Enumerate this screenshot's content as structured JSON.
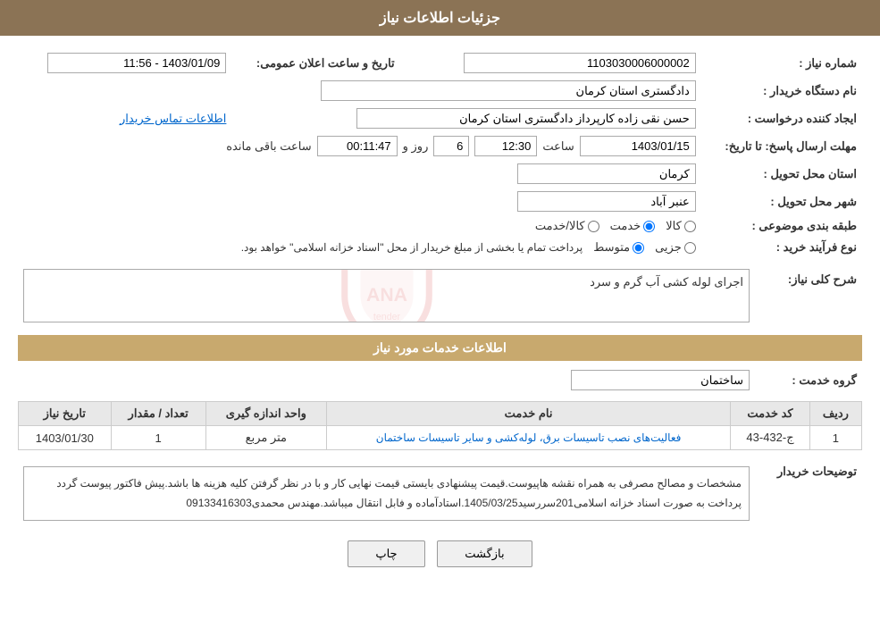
{
  "header": {
    "title": "جزئیات اطلاعات نیاز"
  },
  "fields": {
    "shomara_niaz_label": "شماره نیاز :",
    "shomara_niaz_value": "1103030006000002",
    "nam_dastgah_label": "نام دستگاه خریدار :",
    "nam_dastgah_value": "دادگستری استان کرمان",
    "ijad_konande_label": "ایجاد کننده درخواست :",
    "ijad_konande_value": "حسن نقی زاده کارپرداز دادگستری استان کرمان",
    "ettelaat_tamas_link": "اطلاعات تماس خریدار",
    "mohlat_ersal_label": "مهلت ارسال پاسخ: تا تاریخ:",
    "date_value": "1403/01/15",
    "saat_label": "ساعت",
    "saat_value": "12:30",
    "rooz_label": "روز و",
    "rooz_value": "6",
    "saat_baqi_label": "ساعت باقی مانده",
    "saat_baqi_value": "00:11:47",
    "ostan_label": "استان محل تحویل :",
    "ostan_value": "کرمان",
    "shahr_label": "شهر محل تحویل :",
    "shahr_value": "عنبر آباد",
    "tabaghe_label": "طبقه بندی موضوعی :",
    "tabaghe_options": [
      "کالا",
      "خدمت",
      "کالا/خدمت"
    ],
    "tabaghe_selected": "خدمت",
    "noe_farayand_label": "نوع فرآیند خرید :",
    "noe_options": [
      "جزیی",
      "متوسط"
    ],
    "noe_description": "پرداخت تمام یا بخشی از مبلغ خریدار از محل \"اسناد خزانه اسلامی\" خواهد بود.",
    "tarikh_elam_label": "تاریخ و ساعت اعلان عمومی:",
    "tarikh_elam_value": "1403/01/09 - 11:56",
    "sharh_label": "شرح کلی نیاز:",
    "sharh_value": "اجرای لوله کشی آب گرم و سرد",
    "services_section_title": "اطلاعات خدمات مورد نیاز",
    "gorohe_khadamat_label": "گروه خدمت :",
    "gorohe_khadamat_value": "ساختمان",
    "table_headers": [
      "ردیف",
      "کد خدمت",
      "نام خدمت",
      "واحد اندازه گیری",
      "تعداد / مقدار",
      "تاریخ نیاز"
    ],
    "table_rows": [
      {
        "radif": "1",
        "kod_khadamat": "ج-432-43",
        "nam_khadamat": "فعالیت‌های نصب تاسیسات برق، لوله‌کشی و سایر تاسیسات ساختمان",
        "vahed": "متر مربع",
        "tedaad": "1",
        "tarikh": "1403/01/30"
      }
    ],
    "tosifat_label": "توضیحات خریدار",
    "tosifat_value": "مشخصات و مصالح مصرفی به همراه نقشه هاپیوست.قیمت پیشنهادی بایستی قیمت نهایی کار و با در نظر گرفتن کلیه هزینه ها باشد.پیش فاکتور پیوست گردد پرداخت به صورت اسناد خزانه اسلامی201سررسید1405/03/25.استادآماده و فابل انتقال میباشد.مهندس محمدی09133416303",
    "buttons": {
      "chap": "چاپ",
      "bazgasht": "بازگشت"
    }
  }
}
